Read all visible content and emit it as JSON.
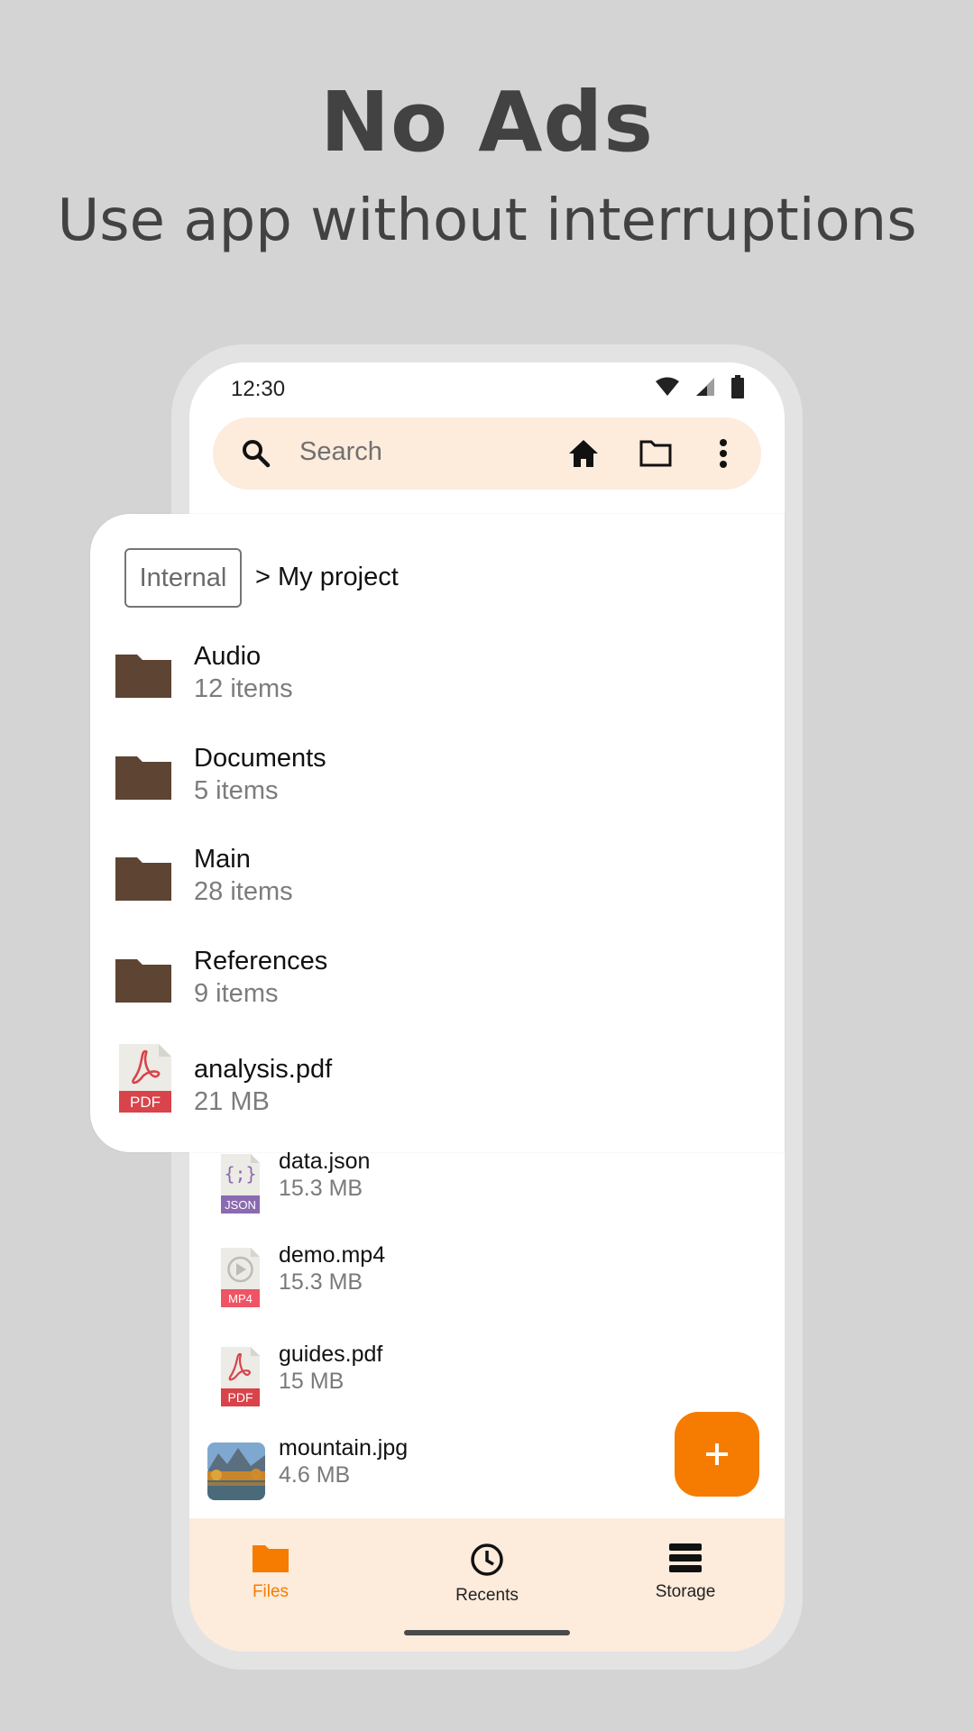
{
  "promo": {
    "headline": "No Ads",
    "subline": "Use app without interruptions"
  },
  "status": {
    "time": "12:30"
  },
  "search": {
    "placeholder": "Search"
  },
  "breadcrumb": {
    "root": "Internal",
    "path": "> My project"
  },
  "overlay_items": [
    {
      "name": "Audio",
      "sub": "12 items",
      "icon": "folder-icon"
    },
    {
      "name": "Documents",
      "sub": "5 items",
      "icon": "folder-icon"
    },
    {
      "name": "Main",
      "sub": "28 items",
      "icon": "folder-icon"
    },
    {
      "name": "References",
      "sub": "9 items",
      "icon": "folder-icon"
    },
    {
      "name": "analysis.pdf",
      "sub": "21 MB",
      "icon": "pdf-file-icon",
      "badge": "PDF"
    }
  ],
  "files": [
    {
      "name": "data.json",
      "size": "15.3 MB",
      "icon": "json-file-icon",
      "badge": "JSON",
      "glyph": "{;}"
    },
    {
      "name": "demo.mp4",
      "size": "15.3 MB",
      "icon": "mp4-file-icon",
      "badge": "MP4"
    },
    {
      "name": "guides.pdf",
      "size": "15 MB",
      "icon": "pdf-file-icon",
      "badge": "PDF"
    },
    {
      "name": "mountain.jpg",
      "size": "4.6 MB",
      "icon": "image-thumbnail"
    }
  ],
  "fab": {
    "label": "+"
  },
  "nav": [
    {
      "label": "Files",
      "icon": "folder-icon",
      "active": true
    },
    {
      "label": "Recents",
      "icon": "clock-icon",
      "active": false
    },
    {
      "label": "Storage",
      "icon": "storage-icon",
      "active": false
    }
  ],
  "colors": {
    "accent": "#f57c00",
    "search_bg": "#fdebdc",
    "folder": "#5d4433",
    "pdf": "#d9434a",
    "json": "#8a6ab0",
    "mp4": "#ef5464",
    "page_bg": "#d4d4d4"
  }
}
